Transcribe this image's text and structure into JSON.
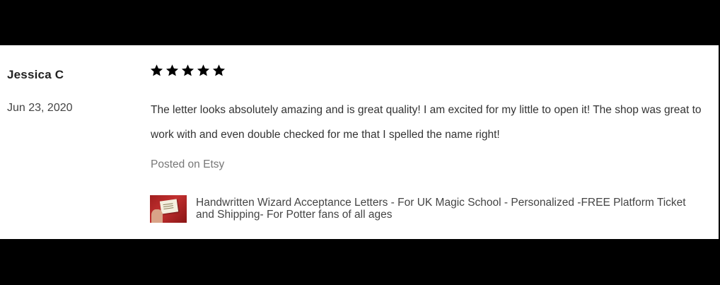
{
  "review": {
    "reviewer_name": "Jessica C",
    "date": "Jun 23, 2020",
    "rating": 5,
    "rating_max": 5,
    "text": "The letter looks absolutely amazing and is great quality! I am excited for my little to open it! The shop was great to work with and even double checked for me that I spelled the name right!",
    "posted_on": "Posted on Etsy"
  },
  "listing": {
    "title": "Handwritten Wizard Acceptance Letters - For UK Magic School - Personalized -FREE Platform Ticket and Shipping- For Potter fans of all ages",
    "thumbnail_icon": "listing-thumbnail"
  },
  "colors": {
    "background": "#000000",
    "card": "#ffffff",
    "star": "#000000",
    "text": "#333333",
    "muted": "#777777"
  }
}
